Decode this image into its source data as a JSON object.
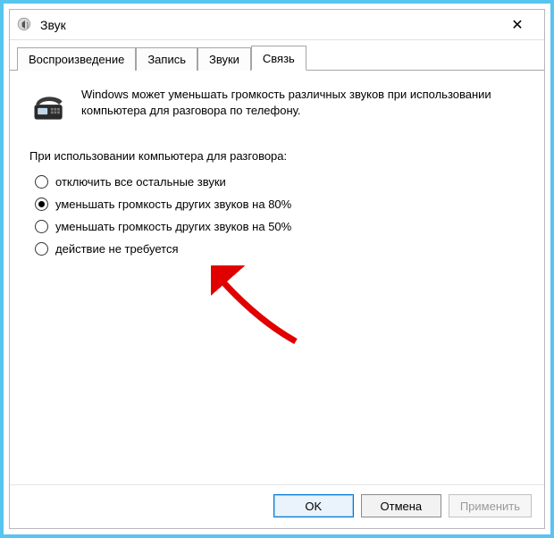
{
  "window": {
    "title": "Звук",
    "close_glyph": "✕"
  },
  "tabs": {
    "playback": "Воспроизведение",
    "recording": "Запись",
    "sounds": "Звуки",
    "communications": "Связь"
  },
  "intro_text": "Windows может уменьшать громкость различных звуков при использовании компьютера для разговора по телефону.",
  "section_label": "При использовании компьютера для разговора:",
  "options": {
    "mute": "отключить все остальные звуки",
    "reduce80": "уменьшать громкость других звуков на 80%",
    "reduce50": "уменьшать громкость других звуков на 50%",
    "none": "действие не требуется"
  },
  "selected": "reduce80",
  "buttons": {
    "ok": "OK",
    "cancel": "Отмена",
    "apply": "Применить"
  }
}
